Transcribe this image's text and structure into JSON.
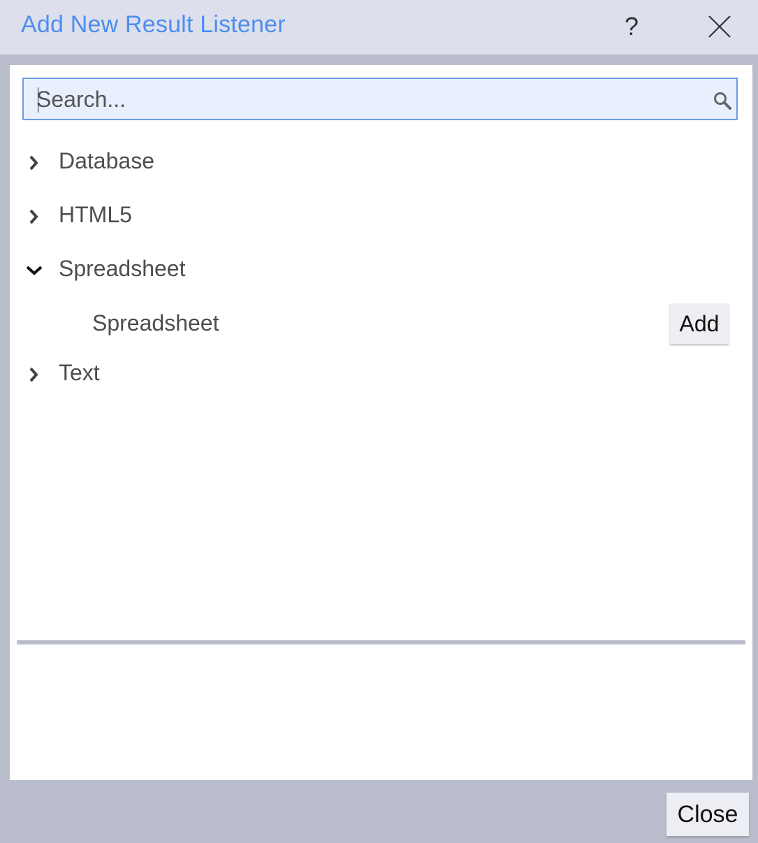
{
  "dialog": {
    "title": "Add New Result Listener",
    "help_label": "?",
    "close_label": "Close"
  },
  "search": {
    "placeholder": "Search...",
    "value": ""
  },
  "tree": {
    "items": [
      {
        "label": "Database",
        "expanded": false,
        "icon": "chevron-right-icon"
      },
      {
        "label": "HTML5",
        "expanded": false,
        "icon": "chevron-right-icon"
      },
      {
        "label": "Spreadsheet",
        "expanded": true,
        "icon": "chevron-down-icon",
        "children": [
          {
            "label": "Spreadsheet",
            "action_label": "Add"
          }
        ]
      },
      {
        "label": "Text",
        "expanded": false,
        "icon": "chevron-right-icon"
      }
    ]
  },
  "colors": {
    "title": "#4d8df0",
    "titlebar_bg": "#dde0ec",
    "frame_bg": "#babdcb",
    "search_bg": "#e8f0fd",
    "search_border": "#6b9de6"
  }
}
